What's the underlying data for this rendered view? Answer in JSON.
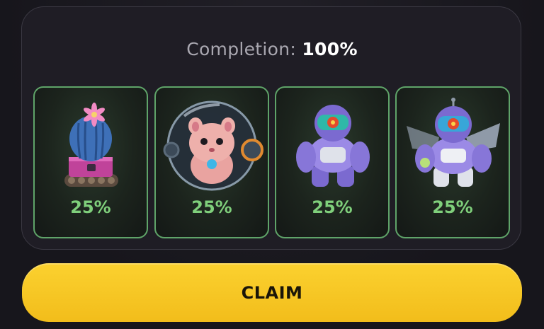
{
  "completion": {
    "label": "Completion:",
    "value": "100%"
  },
  "cards": [
    {
      "icon": "cactus-tank-icon",
      "percent": "25%"
    },
    {
      "icon": "hamster-ball-icon",
      "percent": "25%"
    },
    {
      "icon": "purple-robot-icon",
      "percent": "25%"
    },
    {
      "icon": "winged-robot-icon",
      "percent": "25%"
    }
  ],
  "claim_button": {
    "label": "CLAIM"
  },
  "colors": {
    "accent_yellow": "#f6c521",
    "card_border_green": "#5fa469",
    "percent_green": "#7fcf7b"
  }
}
